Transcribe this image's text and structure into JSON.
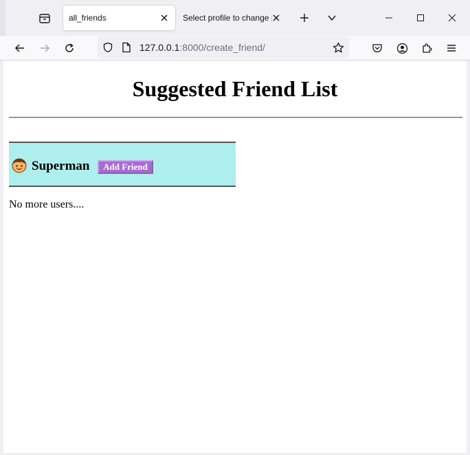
{
  "browser": {
    "tabs": [
      {
        "title": "all_friends",
        "active": true
      },
      {
        "title": "Select profile to change | D",
        "active": false
      }
    ],
    "url": {
      "host": "127.0.0.1",
      "path": ":8000/create_friend/"
    }
  },
  "page": {
    "title": "Suggested Friend List",
    "friends": [
      {
        "name": "Superman",
        "button_label": "Add Friend"
      }
    ],
    "empty_message": "No more users...."
  },
  "colors": {
    "card_background": "#afeeee",
    "button_background": "#a86ad6"
  },
  "icons": [
    "tab-list-icon",
    "close-icon",
    "new-tab-icon",
    "chevron-down-icon",
    "minimize-icon",
    "maximize-icon",
    "window-close-icon",
    "back-arrow-icon",
    "forward-arrow-icon",
    "reload-icon",
    "shield-icon",
    "page-icon",
    "bookmark-star-icon",
    "pocket-icon",
    "account-icon",
    "extensions-icon",
    "menu-icon",
    "avatar-icon"
  ]
}
